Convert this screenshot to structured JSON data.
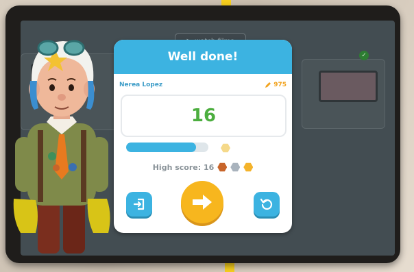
{
  "background_screen": {
    "top_button_label": "watch films"
  },
  "dialog": {
    "title": "Well done!",
    "user_name": "Nerea Lopez",
    "coins": "975",
    "score": "16",
    "progress_fraction": 0.85,
    "high_score_label": "High score: 16"
  },
  "icons": {
    "coin": "pencil-coin-icon",
    "exit": "exit-icon",
    "next": "arrow-right-icon",
    "restart": "restart-icon",
    "medals": [
      "bronze-medal-icon",
      "silver-medal-icon",
      "gold-medal-icon"
    ]
  },
  "colors": {
    "header_blue": "#3cb3e1",
    "score_green": "#4cae3f",
    "next_orange": "#f7b61e"
  }
}
